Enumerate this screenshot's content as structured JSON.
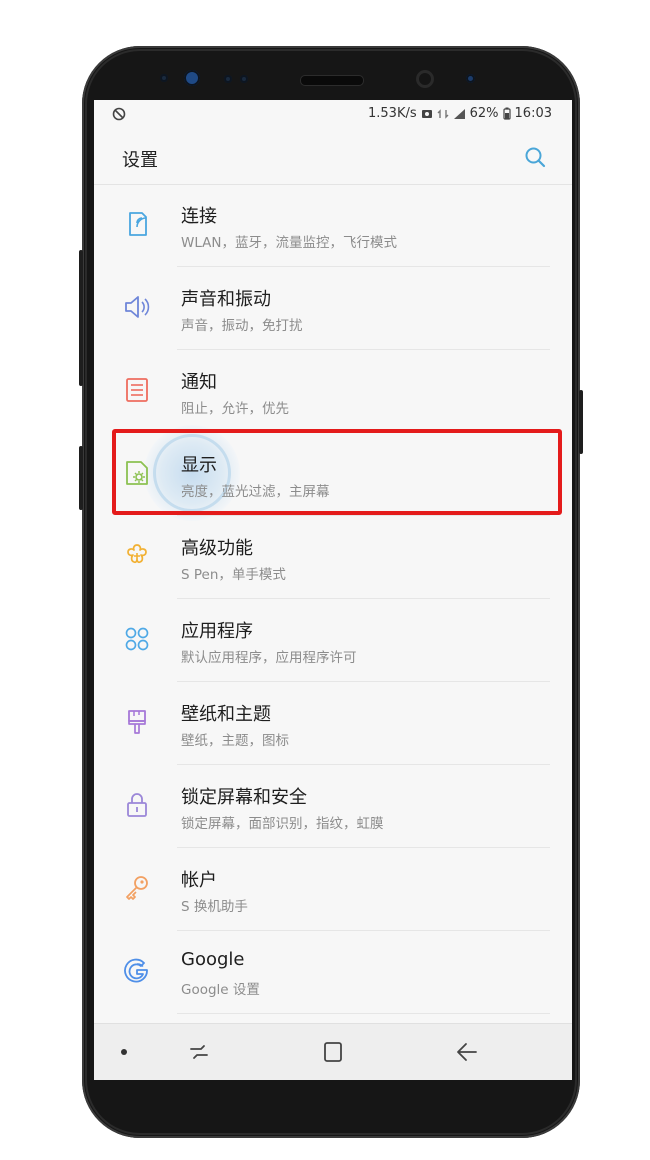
{
  "status_bar": {
    "left_icon": "nfc-icon",
    "network_speed": "1.53K/s",
    "battery_percent": "62%",
    "time": "16:03"
  },
  "app_bar": {
    "title": "设置",
    "search_icon": "search-icon"
  },
  "settings": [
    {
      "label": "连接",
      "sub": "WLAN，蓝牙，流量监控，飞行模式",
      "icon": "connection-icon",
      "color": "#4aa6e0"
    },
    {
      "label": "声音和振动",
      "sub": "声音，振动，免打扰",
      "icon": "speaker-icon",
      "color": "#6f86d9"
    },
    {
      "label": "通知",
      "sub": "阻止，允许，优先",
      "icon": "notification-icon",
      "color": "#ee6d5f"
    },
    {
      "label": "显示",
      "sub": "亮度，蓝光过滤，主屏幕",
      "icon": "display-icon",
      "color": "#8cc152"
    },
    {
      "label": "高级功能",
      "sub": "S Pen，单手模式",
      "icon": "advanced-features-icon",
      "color": "#f2b134"
    },
    {
      "label": "应用程序",
      "sub": "默认应用程序，应用程序许可",
      "icon": "apps-icon",
      "color": "#4fa9e6"
    },
    {
      "label": "壁纸和主题",
      "sub": "壁纸，主题，图标",
      "icon": "brush-icon",
      "color": "#a678d8"
    },
    {
      "label": "锁定屏幕和安全",
      "sub": "锁定屏幕，面部识别，指纹，虹膜",
      "icon": "lock-icon",
      "color": "#9b87d8"
    },
    {
      "label": "帐户",
      "sub": "S 换机助手",
      "icon": "key-icon",
      "color": "#f2a062"
    },
    {
      "label": "Google",
      "sub": "Google 设置",
      "icon": "google-icon",
      "color": "#4f8fe8"
    }
  ],
  "highlighted_item": "显示",
  "colors": {
    "highlight_border": "#e41b1b",
    "search_accent": "#4aa6d8"
  },
  "nav_bar": {
    "dot_icon": "dot-icon",
    "recents_icon": "recents-icon",
    "home_icon": "home-icon",
    "back_icon": "back-icon"
  }
}
